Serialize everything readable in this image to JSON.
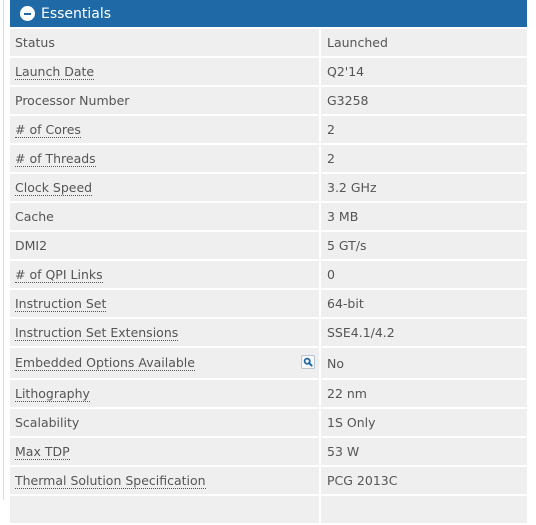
{
  "section": {
    "title": "Essentials",
    "icon": "collapse-minus-icon",
    "header_color": "#1f6aa6"
  },
  "specs": [
    {
      "label": "Status",
      "value": "Launched",
      "has_tooltip": false
    },
    {
      "label": "Launch Date",
      "value": "Q2'14",
      "has_tooltip": true
    },
    {
      "label": "Processor Number",
      "value": "G3258",
      "has_tooltip": false
    },
    {
      "label": "# of Cores",
      "value": "2",
      "has_tooltip": true
    },
    {
      "label": "# of Threads",
      "value": "2",
      "has_tooltip": true
    },
    {
      "label": "Clock Speed",
      "value": "3.2 GHz",
      "has_tooltip": true
    },
    {
      "label": "Cache",
      "value": "3 MB",
      "has_tooltip": false
    },
    {
      "label": "DMI2",
      "value": "5 GT/s",
      "has_tooltip": false
    },
    {
      "label": "# of QPI Links",
      "value": "0",
      "has_tooltip": true
    },
    {
      "label": "Instruction Set",
      "value": "64-bit",
      "has_tooltip": true
    },
    {
      "label": "Instruction Set Extensions",
      "value": "SSE4.1/4.2",
      "has_tooltip": true
    },
    {
      "label": "Embedded Options Available",
      "value": "No",
      "has_tooltip": true,
      "search_icon": "search-icon"
    },
    {
      "label": "Lithography",
      "value": "22 nm",
      "has_tooltip": true
    },
    {
      "label": "Scalability",
      "value": "1S Only",
      "has_tooltip": false
    },
    {
      "label": "Max TDP",
      "value": "53 W",
      "has_tooltip": true
    },
    {
      "label": "Thermal Solution Specification",
      "value": "PCG 2013C",
      "has_tooltip": true
    },
    {
      "label": "",
      "value": "",
      "has_tooltip": false
    }
  ]
}
